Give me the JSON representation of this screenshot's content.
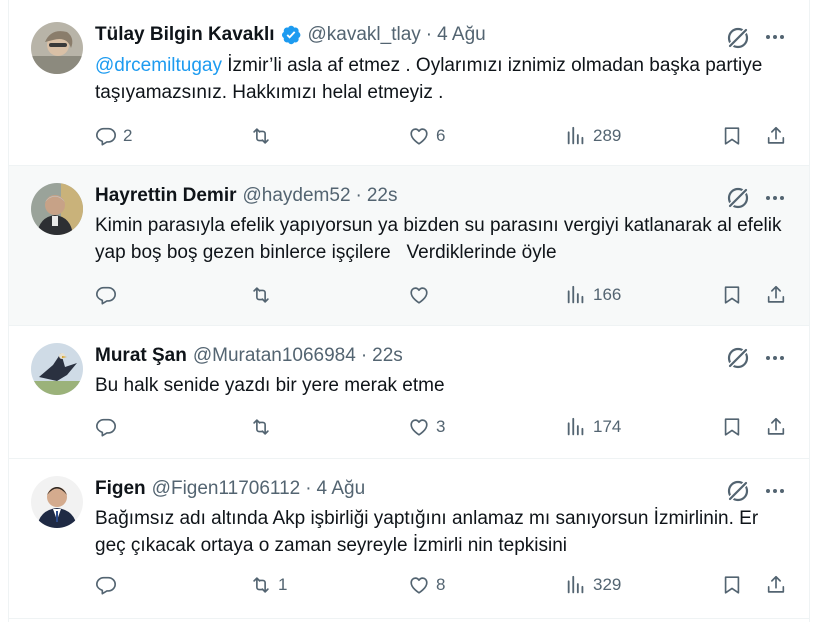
{
  "tweets": [
    {
      "name": "Tülay Bilgin Kavaklı",
      "verified": true,
      "handle": "@kavakl_tlay",
      "sep": "·",
      "time": "4 Ağu",
      "mention": "@drcemiltugay",
      "text": " İzmir’li asla af etmez . Oylarımızı iznimiz olmadan başka partiye taşıyamazsınız. Hakkımızı helal etmeyiz .",
      "replies": "2",
      "retweets": "",
      "likes": "6",
      "views": "289",
      "highlighted": false
    },
    {
      "name": "Hayrettin Demir",
      "verified": false,
      "handle": "@haydem52",
      "sep": "·",
      "time": "22s",
      "mention": "",
      "text": "Kimin parasıyla efelik yapıyorsun ya bizden su parasını vergiyi katlanarak al efelik yap boş boş gezen binlerce işçilere   Verdiklerinde öyle",
      "replies": "",
      "retweets": "",
      "likes": "",
      "views": "166",
      "highlighted": true
    },
    {
      "name": "Murat Şan",
      "verified": false,
      "handle": "@Muratan1066984",
      "sep": "·",
      "time": "22s",
      "mention": "",
      "text": "Bu halk senide yazdı bir yere merak etme",
      "replies": "",
      "retweets": "",
      "likes": "3",
      "views": "174",
      "highlighted": false
    },
    {
      "name": "Figen",
      "verified": false,
      "handle": "@Figen11706112",
      "sep": "·",
      "time": "4 Ağu",
      "mention": "",
      "text": "Bağımsız adı altında Akp işbirliği yaptığını anlamaz mı sanıyorsun İzmirlinin. Er geç çıkacak ortaya o zaman seyreyle İzmirli nin tepkisini",
      "replies": "",
      "retweets": "1",
      "likes": "8",
      "views": "329",
      "highlighted": false
    }
  ],
  "icons": {
    "reply": "reply-icon",
    "retweet": "retweet-icon",
    "like": "like-icon",
    "views": "views-icon",
    "bookmark": "bookmark-icon",
    "share": "share-icon",
    "grok": "grok-icon",
    "more": "more-icon",
    "verified": "verified-badge-icon"
  },
  "colors": {
    "text": "#0f1419",
    "secondary": "#536471",
    "accent": "#1d9bf0",
    "border": "#eff3f4",
    "highlight_bg": "#f7f9f9"
  }
}
